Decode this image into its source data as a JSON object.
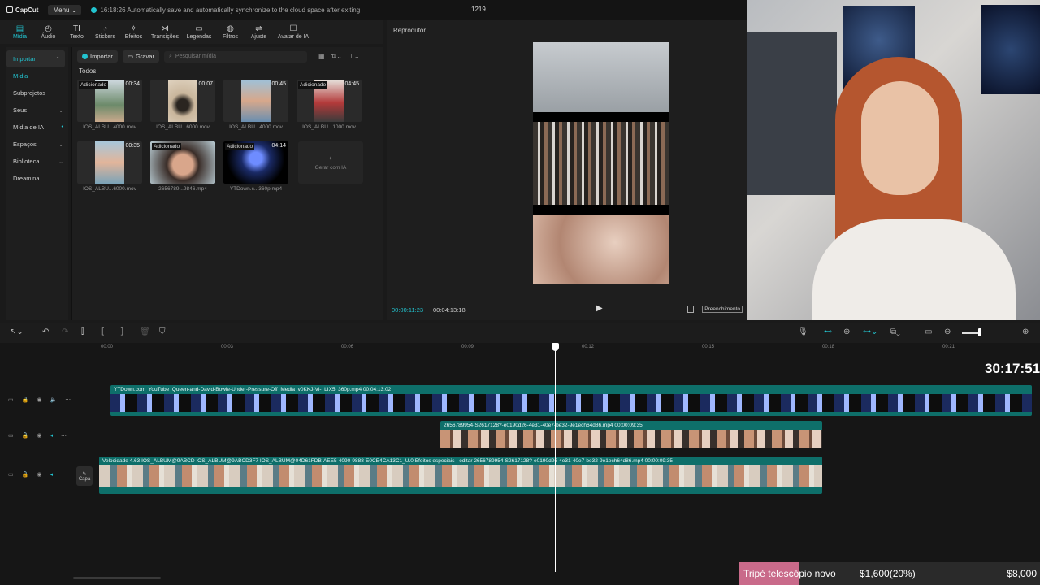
{
  "topbar": {
    "logo": "CapCut",
    "menu_label": "Menu",
    "save_status": "16:18:26 Automatically save and automatically synchronize to the cloud space after exiting",
    "project_title": "1219"
  },
  "toolbar": {
    "tools": [
      {
        "label": "Mídia",
        "icon": "media-icon",
        "glyph": "▤"
      },
      {
        "label": "Áudio",
        "icon": "audio-icon",
        "glyph": "◴"
      },
      {
        "label": "Texto",
        "icon": "text-icon",
        "glyph": "TI"
      },
      {
        "label": "Stickers",
        "icon": "sticker-icon",
        "glyph": "◔"
      },
      {
        "label": "Efeitos",
        "icon": "effects-icon",
        "glyph": "✧"
      },
      {
        "label": "Transições",
        "icon": "transitions-icon",
        "glyph": "⋈"
      },
      {
        "label": "Legendas",
        "icon": "captions-icon",
        "glyph": "▭"
      },
      {
        "label": "Filtros",
        "icon": "filters-icon",
        "glyph": "◍"
      },
      {
        "label": "Ajuste",
        "icon": "adjust-icon",
        "glyph": "⇌"
      },
      {
        "label": "Avatar de IA",
        "icon": "ai-avatar-icon",
        "glyph": "☐"
      }
    ]
  },
  "leftnav": {
    "items": [
      {
        "label": "Importar",
        "caret": "⌃"
      },
      {
        "label": "Mídia",
        "caret": ""
      },
      {
        "label": "Subprojetos",
        "caret": ""
      },
      {
        "label": "Seus",
        "caret": "⌄"
      },
      {
        "label": "Mídia de IA",
        "caret": "•"
      },
      {
        "label": "Espaços",
        "caret": "⌄"
      },
      {
        "label": "Biblioteca",
        "caret": "⌄"
      },
      {
        "label": "Dreamina",
        "caret": ""
      }
    ]
  },
  "media": {
    "import_label": "Importar",
    "record_label": "Gravar",
    "search_placeholder": "Pesquisar mídia",
    "section": "Todos",
    "clips": [
      {
        "name": "IOS_ALBU...4000.mov",
        "duration": "00:34",
        "badge": "Adicionado"
      },
      {
        "name": "IOS_ALBU...6000.mov",
        "duration": "00:07",
        "badge": ""
      },
      {
        "name": "IOS_ALBU...4000.mov",
        "duration": "00:45",
        "badge": ""
      },
      {
        "name": "IOS_ALBU...1000.mov",
        "duration": "04:45",
        "badge": "Adicionado"
      },
      {
        "name": "IOS_ALBU...6000.mov",
        "duration": "00:35",
        "badge": ""
      },
      {
        "name": "2656789...9846.mp4",
        "duration": "",
        "badge": "Adicionado"
      },
      {
        "name": "YTDown.c...360p.mp4",
        "duration": "04:14",
        "badge": "Adicionado"
      }
    ],
    "generate_label": "Gerar com IA"
  },
  "player": {
    "title": "Reprodutor",
    "current_time": "00:00:11:23",
    "total_time": "00:04:13:18",
    "fill_label": "Preenchimento"
  },
  "timeline": {
    "ruler": [
      "00:00",
      "00:03",
      "00:06",
      "00:09",
      "00:12",
      "00:15",
      "00:18",
      "00:21"
    ],
    "tracks": [
      {
        "label": "YTDown.com_YouTube_Queen-and-David-Bowie-Under-Pressure-Off_Media_v0KKJ-Vl-_LIX5_360p.mp4   00:04:13:02"
      },
      {
        "label": "2656789954-S2617128?-e0190d26-4e31-40e7-be32-9e1ech64d86.mp4   00:00:09:35"
      },
      {
        "label": "Velocidade 4.63   IOS_ALBUM@9ABCD   IOS_ALBUM@9ABCD3F7   IOS_ALBUM@04D61FDB-AEE5-4090-9888-E0CE4CA13C1_U.0   Efeitos especiais - editar   2656789954-S2617128?-e0190d26-4e31-40e7-be32-9e1ech64d86.mp4   00:00:09:35"
      }
    ],
    "cover_label": "Capa"
  },
  "overlay": {
    "timer": "30:17:51",
    "goal_name": "Tripé telescópio novo",
    "goal_amount": "$1,600(20%)",
    "goal_target": "$8,000",
    "goal_progress": 0.2
  },
  "colors": {
    "accent": "#22c3cf",
    "clip": "#0e6f6a",
    "goal": "#c96a8a"
  }
}
